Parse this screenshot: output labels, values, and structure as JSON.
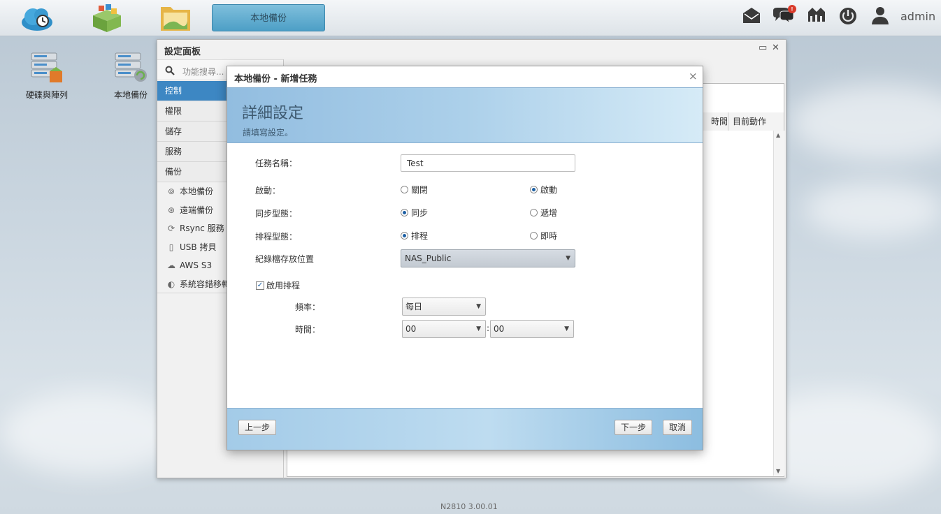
{
  "taskbar": {
    "apps": [
      {
        "name": "cloud-app-icon"
      },
      {
        "name": "app-center-icon"
      },
      {
        "name": "file-browser-icon"
      }
    ],
    "active_task": "本地備份",
    "user": "admin"
  },
  "desktop": {
    "icons": [
      {
        "label": "硬碟與陣列",
        "icon": "raid-icon"
      },
      {
        "label": "本地備份",
        "icon": "local-backup-icon"
      }
    ]
  },
  "panel": {
    "title": "設定面板",
    "search_placeholder": "功能搜尋...",
    "nav": [
      {
        "label": "控制",
        "active": true
      },
      {
        "label": "權限"
      },
      {
        "label": "儲存"
      },
      {
        "label": "服務"
      },
      {
        "label": "備份"
      }
    ],
    "backup_items": [
      {
        "label": "本地備份",
        "icon": "local-backup-icon"
      },
      {
        "label": "遠端備份",
        "icon": "remote-backup-icon"
      },
      {
        "label": "Rsync 服務",
        "icon": "sync-icon"
      },
      {
        "label": "USB 拷貝",
        "icon": "usb-icon"
      },
      {
        "label": "AWS S3",
        "icon": "cloud-icon"
      },
      {
        "label": "系統容錯移轉",
        "icon": "failover-icon"
      }
    ],
    "columns": [
      "時間",
      "目前動作"
    ]
  },
  "dialog": {
    "title": "本地備份 - 新增任務",
    "header_title": "詳細設定",
    "header_subtitle": "請填寫設定。",
    "task_name_label": "任務名稱：",
    "task_name_value": "Test",
    "enable_label": "啟動：",
    "enable_off": "關閉",
    "enable_on": "啟動",
    "sync_type_label": "同步型態：",
    "sync_opt": "同步",
    "incremental_opt": "遞增",
    "schedule_type_label": "排程型態：",
    "schedule_opt": "排程",
    "immediate_opt": "即時",
    "log_location_label": "紀錄檔存放位置",
    "log_location_value": "NAS_Public",
    "enable_schedule_label": "啟用排程",
    "frequency_label": "頻率：",
    "frequency_value": "每日",
    "time_label": "時間：",
    "time_hour": "00",
    "time_minute": "00",
    "time_separator": ":",
    "prev_label": "上一步",
    "next_label": "下一步",
    "cancel_label": "取消"
  },
  "version": "N2810   3.00.01",
  "colors": {
    "accent": "#3d87c3",
    "band": "#acd0ea",
    "radio_selected": "#1c5fa4"
  }
}
